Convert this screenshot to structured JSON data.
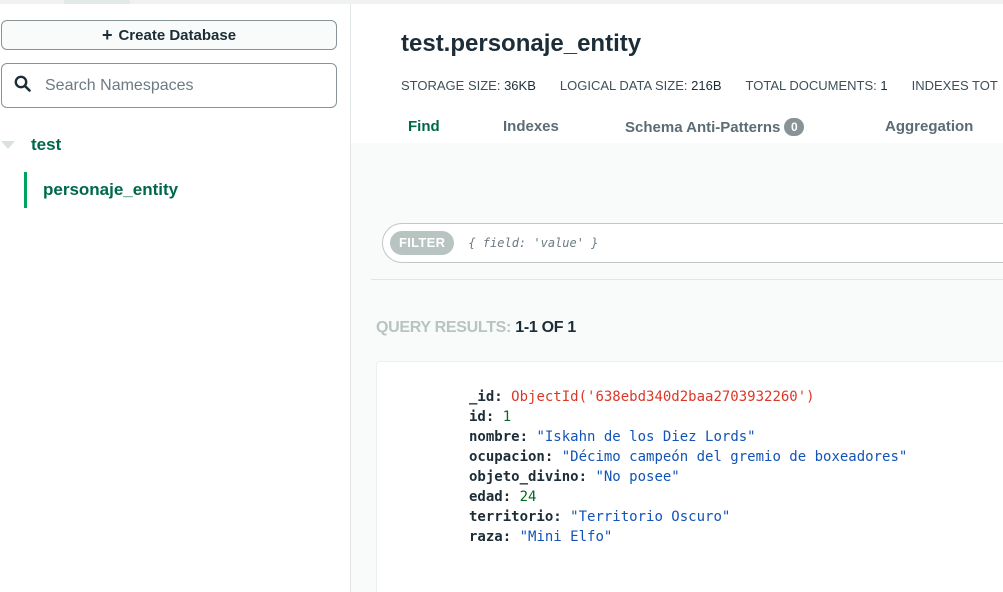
{
  "sidebar": {
    "create_button": "Create Database",
    "search_placeholder": "Search Namespaces",
    "database": "test",
    "collection": "personaje_entity"
  },
  "header": {
    "title": "test.personaje_entity",
    "stats": [
      {
        "label": "STORAGE SIZE:",
        "value": "36KB"
      },
      {
        "label": "LOGICAL DATA SIZE:",
        "value": "216B"
      },
      {
        "label": "TOTAL DOCUMENTS:",
        "value": "1"
      },
      {
        "label": "INDEXES TOT",
        "value": ""
      }
    ]
  },
  "tabs": [
    {
      "label": "Find",
      "active": true
    },
    {
      "label": "Indexes"
    },
    {
      "label": "Schema Anti-Patterns",
      "badge": "0"
    },
    {
      "label": "Aggregation"
    }
  ],
  "filter": {
    "label": "FILTER",
    "placeholder": "{ field: 'value' }"
  },
  "results": {
    "label": "QUERY RESULTS:",
    "range": "1-1 OF 1"
  },
  "document": [
    {
      "key": "_id:",
      "value": "ObjectId('638ebd340d2baa2703932260')",
      "type": "oid"
    },
    {
      "key": "id:",
      "value": "1",
      "type": "num"
    },
    {
      "key": "nombre:",
      "value": "\"Iskahn de los Diez Lords\"",
      "type": "str"
    },
    {
      "key": "ocupacion:",
      "value": "\"Décimo campeón del gremio de boxeadores\"",
      "type": "str"
    },
    {
      "key": "objeto_divino:",
      "value": "\"No posee\"",
      "type": "str"
    },
    {
      "key": "edad:",
      "value": "24",
      "type": "num"
    },
    {
      "key": "territorio:",
      "value": "\"Territorio Oscuro\"",
      "type": "str"
    },
    {
      "key": "raza:",
      "value": "\"Mini Elfo\"",
      "type": "str"
    }
  ]
}
